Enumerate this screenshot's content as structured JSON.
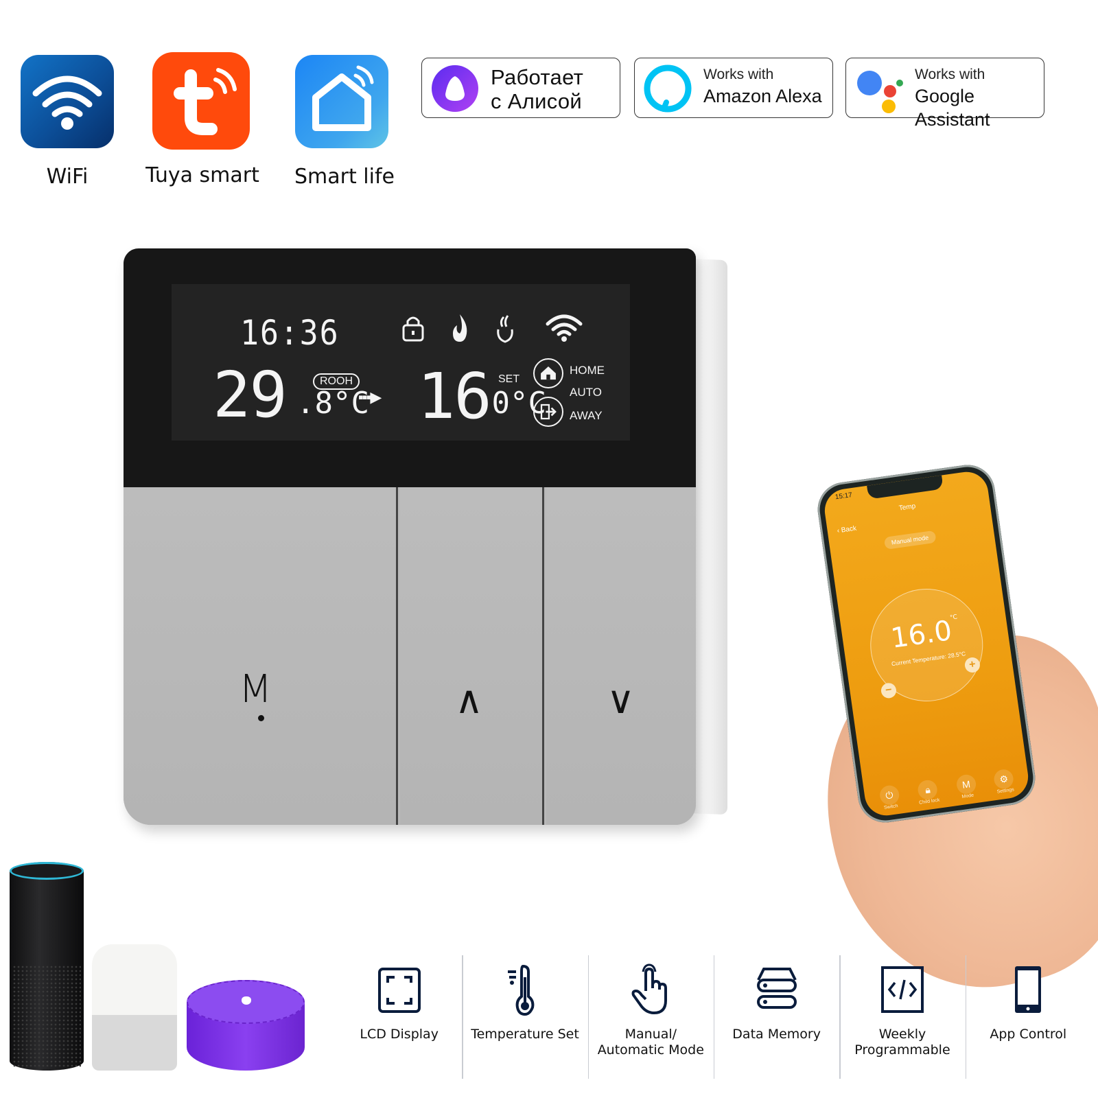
{
  "apps": [
    {
      "id": "wifi",
      "label": "WiFi",
      "color": "#0c4f99"
    },
    {
      "id": "tuya",
      "label": "Tuya smart",
      "color": "#ff4a0c"
    },
    {
      "id": "smart_life",
      "label": "Smart life",
      "color": "#2a96f0"
    }
  ],
  "badges": {
    "alice": {
      "line1": "Работает",
      "line2": "с Алисой",
      "color": "#7b3bf2"
    },
    "alexa": {
      "small": "Works with",
      "big": "Amazon Alexa",
      "color": "#00c3f4"
    },
    "google": {
      "small": "Works with",
      "big": "Google Assistant",
      "colors": [
        "#4285f4",
        "#ea4335",
        "#fbbc05",
        "#34a853"
      ]
    }
  },
  "thermostat": {
    "time": "16:36",
    "room_temp_int": "29",
    "room_temp_dec": ".8",
    "room_unit": "°C",
    "room_tag": "ROOH",
    "arrow": "▪▪▪▶",
    "set_temp_int": "16",
    "set_temp_dec": ".0",
    "set_unit": "°C",
    "set_label": "SET",
    "status_icons": [
      "lock-icon",
      "flame-icon",
      "heating-hand-icon",
      "wifi-icon"
    ],
    "modes": {
      "home": "HOME",
      "auto": "AUTO",
      "away": "AWAY"
    },
    "buttons": {
      "mode": "M",
      "up": "∧",
      "down": "∨"
    }
  },
  "phone": {
    "status_time": "15:17",
    "title": "Temp",
    "back": "‹ Back",
    "mode_pill": "Manual mode",
    "set_value": "16.0",
    "set_unit": "°C",
    "current_temperature": "Current Temperature: 28.5°C",
    "minus": "−",
    "plus": "+",
    "nav": [
      {
        "icon": "⏻",
        "label": "Switch"
      },
      {
        "icon": "🔒︎",
        "label": "Child lock"
      },
      {
        "icon": "M",
        "label": "Mode"
      },
      {
        "icon": "⚙",
        "label": "Settings"
      }
    ]
  },
  "features": [
    {
      "icon": "lcd-display-icon",
      "label": "LCD Display"
    },
    {
      "icon": "thermometer-icon",
      "label": "Temperature Set"
    },
    {
      "icon": "hand-pointer-icon",
      "label": "Manual/\nAutomatic Mode"
    },
    {
      "icon": "database-icon",
      "label": "Data Memory"
    },
    {
      "icon": "code-tablet-icon",
      "label": "Weekly\nProgrammable"
    },
    {
      "icon": "smartphone-icon",
      "label": "App Control"
    }
  ]
}
